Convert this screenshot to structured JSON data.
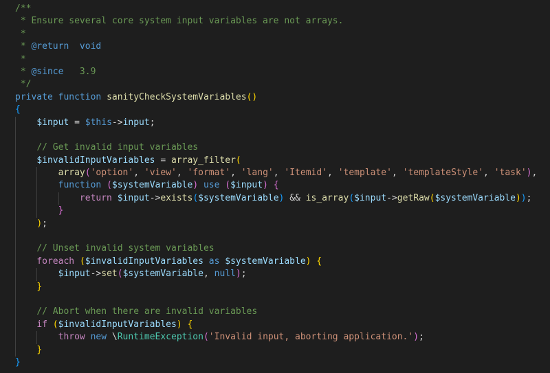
{
  "editor": {
    "language": "php",
    "theme_colors": {
      "background": "#1e1e1e",
      "comment": "#6a9955",
      "keyword": "#569cd6",
      "control": "#c586c0",
      "function": "#dcdcaa",
      "variable": "#9cdcfe",
      "string": "#ce9178",
      "plain": "#d4d4d4",
      "bracket_gold": "#ffd700",
      "bracket_orchid": "#da70d6",
      "bracket_blue": "#179fff"
    },
    "lines": [
      {
        "indent": 0,
        "tokens": [
          {
            "t": "/**",
            "c": "comment"
          }
        ]
      },
      {
        "indent": 0,
        "tokens": [
          {
            "t": " * Ensure several core system input variables are not arrays.",
            "c": "comment"
          }
        ]
      },
      {
        "indent": 0,
        "tokens": [
          {
            "t": " *",
            "c": "comment"
          }
        ]
      },
      {
        "indent": 0,
        "tokens": [
          {
            "t": " * ",
            "c": "comment"
          },
          {
            "t": "@return",
            "c": "doctag"
          },
          {
            "t": "  void",
            "c": "keyword"
          }
        ]
      },
      {
        "indent": 0,
        "tokens": [
          {
            "t": " *",
            "c": "comment"
          }
        ]
      },
      {
        "indent": 0,
        "tokens": [
          {
            "t": " * ",
            "c": "comment"
          },
          {
            "t": "@since",
            "c": "doctag"
          },
          {
            "t": "   3.9",
            "c": "comment"
          }
        ]
      },
      {
        "indent": 0,
        "tokens": [
          {
            "t": " */",
            "c": "comment"
          }
        ]
      },
      {
        "indent": 0,
        "tokens": [
          {
            "t": "private",
            "c": "keyword"
          },
          {
            "t": " ",
            "c": "plain"
          },
          {
            "t": "function",
            "c": "keyword"
          },
          {
            "t": " ",
            "c": "plain"
          },
          {
            "t": "sanityCheckSystemVariables",
            "c": "function"
          },
          {
            "t": "()",
            "c": "bracket1"
          }
        ]
      },
      {
        "indent": 0,
        "tokens": [
          {
            "t": "{",
            "c": "bracket3"
          }
        ]
      },
      {
        "indent": 1,
        "tokens": [
          {
            "t": "$input",
            "c": "variable"
          },
          {
            "t": " = ",
            "c": "plain"
          },
          {
            "t": "$this",
            "c": "this"
          },
          {
            "t": "->",
            "c": "plain"
          },
          {
            "t": "input",
            "c": "variable"
          },
          {
            "t": ";",
            "c": "plain"
          }
        ]
      },
      {
        "indent": 1,
        "tokens": []
      },
      {
        "indent": 1,
        "tokens": [
          {
            "t": "// Get invalid input variables",
            "c": "comment"
          }
        ]
      },
      {
        "indent": 1,
        "tokens": [
          {
            "t": "$invalidInputVariables",
            "c": "variable"
          },
          {
            "t": " = ",
            "c": "plain"
          },
          {
            "t": "array_filter",
            "c": "function"
          },
          {
            "t": "(",
            "c": "bracket1"
          }
        ]
      },
      {
        "indent": 2,
        "tokens": [
          {
            "t": "array",
            "c": "function"
          },
          {
            "t": "(",
            "c": "bracket2"
          },
          {
            "t": "'option'",
            "c": "string"
          },
          {
            "t": ", ",
            "c": "plain"
          },
          {
            "t": "'view'",
            "c": "string"
          },
          {
            "t": ", ",
            "c": "plain"
          },
          {
            "t": "'format'",
            "c": "string"
          },
          {
            "t": ", ",
            "c": "plain"
          },
          {
            "t": "'lang'",
            "c": "string"
          },
          {
            "t": ", ",
            "c": "plain"
          },
          {
            "t": "'Itemid'",
            "c": "string"
          },
          {
            "t": ", ",
            "c": "plain"
          },
          {
            "t": "'template'",
            "c": "string"
          },
          {
            "t": ", ",
            "c": "plain"
          },
          {
            "t": "'templateStyle'",
            "c": "string"
          },
          {
            "t": ", ",
            "c": "plain"
          },
          {
            "t": "'task'",
            "c": "string"
          },
          {
            "t": ")",
            "c": "bracket2"
          },
          {
            "t": ",",
            "c": "plain"
          }
        ]
      },
      {
        "indent": 2,
        "tokens": [
          {
            "t": "function",
            "c": "keyword"
          },
          {
            "t": " ",
            "c": "plain"
          },
          {
            "t": "(",
            "c": "bracket2"
          },
          {
            "t": "$systemVariable",
            "c": "variable"
          },
          {
            "t": ")",
            "c": "bracket2"
          },
          {
            "t": " ",
            "c": "plain"
          },
          {
            "t": "use",
            "c": "keyword"
          },
          {
            "t": " ",
            "c": "plain"
          },
          {
            "t": "(",
            "c": "bracket2"
          },
          {
            "t": "$input",
            "c": "variable"
          },
          {
            "t": ")",
            "c": "bracket2"
          },
          {
            "t": " ",
            "c": "plain"
          },
          {
            "t": "{",
            "c": "bracket2"
          }
        ]
      },
      {
        "indent": 3,
        "tokens": [
          {
            "t": "return",
            "c": "control"
          },
          {
            "t": " ",
            "c": "plain"
          },
          {
            "t": "$input",
            "c": "variable"
          },
          {
            "t": "->",
            "c": "plain"
          },
          {
            "t": "exists",
            "c": "function"
          },
          {
            "t": "(",
            "c": "bracket3"
          },
          {
            "t": "$systemVariable",
            "c": "variable"
          },
          {
            "t": ")",
            "c": "bracket3"
          },
          {
            "t": " && ",
            "c": "plain"
          },
          {
            "t": "is_array",
            "c": "function"
          },
          {
            "t": "(",
            "c": "bracket3"
          },
          {
            "t": "$input",
            "c": "variable"
          },
          {
            "t": "->",
            "c": "plain"
          },
          {
            "t": "getRaw",
            "c": "function"
          },
          {
            "t": "(",
            "c": "bracket1"
          },
          {
            "t": "$systemVariable",
            "c": "variable"
          },
          {
            "t": ")",
            "c": "bracket1"
          },
          {
            "t": ")",
            "c": "bracket3"
          },
          {
            "t": ";",
            "c": "plain"
          }
        ]
      },
      {
        "indent": 2,
        "tokens": [
          {
            "t": "}",
            "c": "bracket2"
          }
        ]
      },
      {
        "indent": 1,
        "tokens": [
          {
            "t": ")",
            "c": "bracket1"
          },
          {
            "t": ";",
            "c": "plain"
          }
        ]
      },
      {
        "indent": 1,
        "tokens": []
      },
      {
        "indent": 1,
        "tokens": [
          {
            "t": "// Unset invalid system variables",
            "c": "comment"
          }
        ]
      },
      {
        "indent": 1,
        "tokens": [
          {
            "t": "foreach",
            "c": "control"
          },
          {
            "t": " ",
            "c": "plain"
          },
          {
            "t": "(",
            "c": "bracket1"
          },
          {
            "t": "$invalidInputVariables",
            "c": "variable"
          },
          {
            "t": " as ",
            "c": "keyword"
          },
          {
            "t": "$systemVariable",
            "c": "variable"
          },
          {
            "t": ")",
            "c": "bracket1"
          },
          {
            "t": " ",
            "c": "plain"
          },
          {
            "t": "{",
            "c": "bracket1"
          }
        ]
      },
      {
        "indent": 2,
        "tokens": [
          {
            "t": "$input",
            "c": "variable"
          },
          {
            "t": "->",
            "c": "plain"
          },
          {
            "t": "set",
            "c": "function"
          },
          {
            "t": "(",
            "c": "bracket2"
          },
          {
            "t": "$systemVariable",
            "c": "variable"
          },
          {
            "t": ", ",
            "c": "plain"
          },
          {
            "t": "null",
            "c": "keyword"
          },
          {
            "t": ")",
            "c": "bracket2"
          },
          {
            "t": ";",
            "c": "plain"
          }
        ]
      },
      {
        "indent": 1,
        "tokens": [
          {
            "t": "}",
            "c": "bracket1"
          }
        ]
      },
      {
        "indent": 1,
        "tokens": []
      },
      {
        "indent": 1,
        "tokens": [
          {
            "t": "// Abort when there are invalid variables",
            "c": "comment"
          }
        ]
      },
      {
        "indent": 1,
        "tokens": [
          {
            "t": "if",
            "c": "control"
          },
          {
            "t": " ",
            "c": "plain"
          },
          {
            "t": "(",
            "c": "bracket1"
          },
          {
            "t": "$invalidInputVariables",
            "c": "variable"
          },
          {
            "t": ")",
            "c": "bracket1"
          },
          {
            "t": " ",
            "c": "plain"
          },
          {
            "t": "{",
            "c": "bracket1"
          }
        ]
      },
      {
        "indent": 2,
        "tokens": [
          {
            "t": "throw",
            "c": "control"
          },
          {
            "t": " ",
            "c": "plain"
          },
          {
            "t": "new",
            "c": "keyword"
          },
          {
            "t": " \\",
            "c": "plain"
          },
          {
            "t": "RuntimeException",
            "c": "type"
          },
          {
            "t": "(",
            "c": "bracket2"
          },
          {
            "t": "'Invalid input, aborting application.'",
            "c": "string"
          },
          {
            "t": ")",
            "c": "bracket2"
          },
          {
            "t": ";",
            "c": "plain"
          }
        ]
      },
      {
        "indent": 1,
        "tokens": [
          {
            "t": "}",
            "c": "bracket1"
          }
        ]
      },
      {
        "indent": 0,
        "tokens": [
          {
            "t": "}",
            "c": "bracket3"
          }
        ]
      }
    ]
  }
}
